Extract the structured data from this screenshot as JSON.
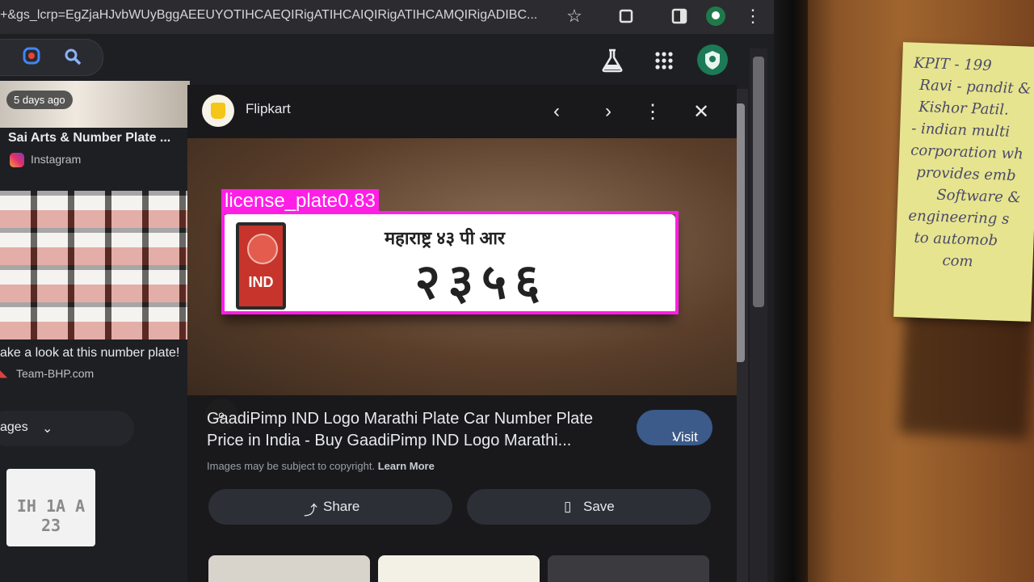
{
  "browser": {
    "url": "+&gs_lcrp=EgZjaHJvbWUyBggAEEUYOTIHCAEQIRigATIHCAIQIRigATIHCAMQIRigADIBC...",
    "icons": [
      "star-icon",
      "extension-icon",
      "sidebar-icon",
      "profile-icon",
      "menu-icon"
    ]
  },
  "toolbar": {
    "icons": [
      "google-lens-icon",
      "search-icon",
      "labs-icon",
      "apps-icon",
      "account-avatar-icon"
    ]
  },
  "results": {
    "first": {
      "badge": "5 days ago",
      "title": "Sai Arts & Number Plate ...",
      "source": "Instagram"
    },
    "second": {
      "title": "ake a look at this number plate!",
      "source": "Team-BHP.com"
    },
    "images_chip": "ages",
    "plate_thumb_text": "IH 1A A 23"
  },
  "preview": {
    "site": "Flipkart",
    "plate": {
      "badge": "IND",
      "top_text": "महाराष्ट्र ४३ पी आर",
      "number": "२३५६"
    },
    "detection": {
      "label": "license_plate0.83",
      "color": "#ff1ee6"
    },
    "title": "GaadiPimp IND Logo Marathi Plate Car Number Plate Price in India - Buy GaadiPimp IND Logo Marathi...",
    "visit_label": "Visit",
    "copyright_note": "Images may be subject to copyright.",
    "learn_more": "Learn More",
    "share_label": "Share",
    "save_label": "Save"
  },
  "sticky_note": {
    "lines": [
      "KPIT - 199",
      "Ravi - pandit &",
      "Kishor Patil.",
      "- indian multi",
      "corporation wh",
      "provides emb",
      "Software &",
      "engineering s",
      "to automob",
      "com"
    ]
  }
}
